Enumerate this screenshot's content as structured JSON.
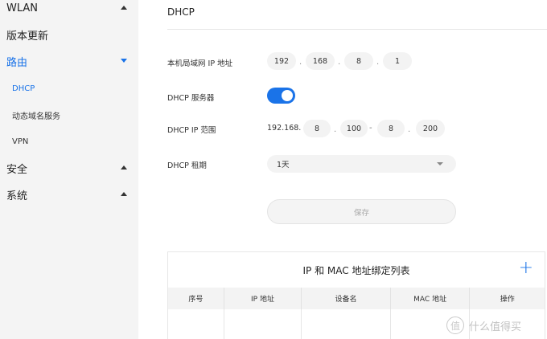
{
  "sidebar": {
    "items": [
      {
        "label": "WLAN",
        "state": "collapsed"
      },
      {
        "label": "版本更新"
      },
      {
        "label": "路由",
        "state": "expanded",
        "active": true
      },
      {
        "label": "DHCP",
        "active": true
      },
      {
        "label": "动态域名服务"
      },
      {
        "label": "VPN"
      },
      {
        "label": "安全",
        "state": "collapsed"
      },
      {
        "label": "系统",
        "state": "collapsed"
      }
    ]
  },
  "main": {
    "title": "DHCP",
    "lan_ip": {
      "label": "本机局域网 IP 地址",
      "octets": [
        "192",
        "168",
        "8",
        "1"
      ]
    },
    "dhcp_server": {
      "label": "DHCP 服务器",
      "enabled": true
    },
    "dhcp_range": {
      "label": "DHCP IP 范围",
      "prefix": "192.168.",
      "start": [
        "8",
        "100"
      ],
      "separator": "-",
      "end": [
        "8",
        "200"
      ]
    },
    "lease": {
      "label": "DHCP 租期",
      "value": "1天"
    },
    "save_label": "保存",
    "binding_table": {
      "title": "IP 和 MAC 地址绑定列表",
      "add_icon": "plus-icon",
      "columns": [
        "序号",
        "IP 地址",
        "设备名",
        "MAC 地址",
        "操作"
      ],
      "rows": []
    }
  },
  "watermark": {
    "badge": "值",
    "text": "什么值得买"
  },
  "colors": {
    "accent": "#1a73e8",
    "sidebar_bg": "#f4f4f4",
    "field_bg": "#f3f3f3"
  }
}
